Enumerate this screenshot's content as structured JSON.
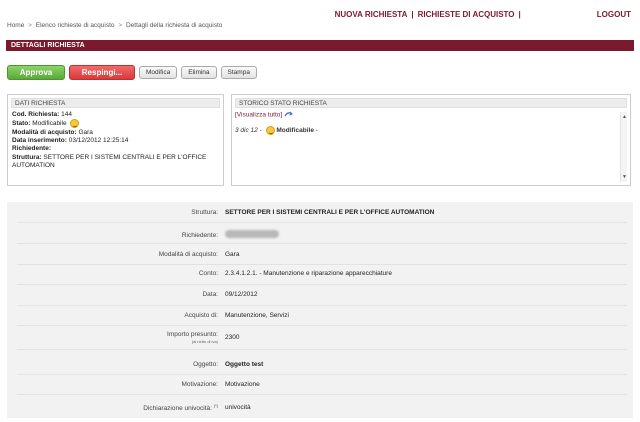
{
  "topnav": {
    "new_request": "NUOVA RICHIESTA",
    "sep": "|",
    "purchase_requests": "RICHIESTE DI ACQUISTO",
    "logout": "LOGOUT"
  },
  "breadcrumb": {
    "home": "Home",
    "arrow": ">",
    "list": "Elenco richieste di acquisto",
    "current": "Dettagli della richiesta di acquisto"
  },
  "title": "DETTAGLI RICHIESTA",
  "toolbar": {
    "approve": "Approva",
    "reject": "Respingi...",
    "edit": "Modifica",
    "delete": "Elimina",
    "print": "Stampa"
  },
  "summary": {
    "heading": "DATI RICHIESTA",
    "code_label": "Cod. Richiesta:",
    "code_value": "144",
    "state_label": "Stato:",
    "state_value": "Modificabile",
    "mode_label": "Modalità di acquisto:",
    "mode_value": "Gara",
    "date_label": "Data inserimento:",
    "date_value": "03/12/2012 12:25:14",
    "requester_label": "Richiedente:",
    "structure_label": "Struttura:",
    "structure_value": "SETTORE PER I SISTEMI CENTRALI E PER L'OFFICE AUTOMATION"
  },
  "history": {
    "heading": "STORICO STATO RICHIESTA",
    "link": "[Visualizza tutto]",
    "entry_date": "3 dic 12",
    "entry_sep": "-",
    "entry_state": "Modificabile",
    "entry_tail": "-"
  },
  "details": {
    "rows": [
      {
        "label": "Struttura:",
        "value": "SETTORE PER I SISTEMI CENTRALI E PER L'OFFICE AUTOMATION"
      },
      {
        "label": "Richiedente:",
        "value": ""
      },
      {
        "label": "Modalità di acquisto:",
        "value": "Gara"
      },
      {
        "label": "Conto:",
        "value": "2.3.4.1.2.1. - Manutenzione e riparazione apparecchiature"
      },
      {
        "label": "Data:",
        "value": "09/12/2012"
      },
      {
        "label": "Acquisto di:",
        "value": "Manutenzione, Servizi"
      },
      {
        "label": "Importo presunto:",
        "sub": "(al netto di iva)",
        "value": "2300"
      },
      {
        "label": "Oggetto:",
        "value": "Oggetto test"
      },
      {
        "label": "Motivazione:",
        "value": "Motivazione"
      },
      {
        "label": "Dichiarazione univocità:",
        "sup": "(*)",
        "value": "univocità"
      }
    ]
  },
  "colors": {
    "brand": "#7b1a2e",
    "approve": "#5aa83a",
    "reject": "#d83a3a"
  },
  "icons": {
    "state": "smiley-icon",
    "history_link": "refresh-icon"
  }
}
